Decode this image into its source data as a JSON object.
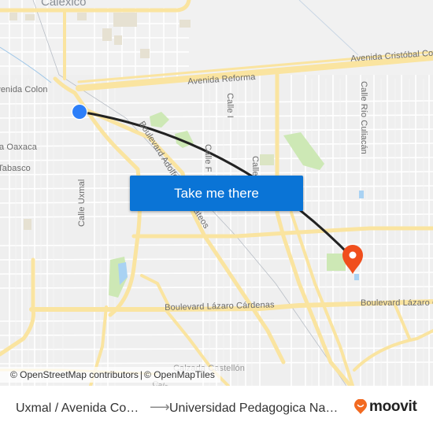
{
  "map": {
    "city_label": "Calexico",
    "street_labels": [
      {
        "id": "avenida-colon",
        "text": "Avenida Colon"
      },
      {
        "id": "avenida-reforma",
        "text": "Avenida Reforma"
      },
      {
        "id": "avenida-cristobal-colon",
        "text": "Avenida Cristóbal Colón"
      },
      {
        "id": "calle-i",
        "text": "Calle I"
      },
      {
        "id": "calle-rio-culiacan",
        "text": "Calle Río Culiacán"
      },
      {
        "id": "avenida-oaxaca",
        "text": "Avenida Oaxaca"
      },
      {
        "id": "avenida-tabasco",
        "text": "Avenida Tabasco"
      },
      {
        "id": "calle-uxmal",
        "text": "Calle Uxmal"
      },
      {
        "id": "boulevard-adolfo-lopez-mateos",
        "text": "Boulevard Adolfo López Mateos"
      },
      {
        "id": "calle-f",
        "text": "Calle F"
      },
      {
        "id": "calle-k",
        "text": "Calle K"
      },
      {
        "id": "boulevard-lazaro-cardenas",
        "text": "Boulevard Lázaro Cárdenas"
      },
      {
        "id": "boulevard-lazaro-cardenas-east",
        "text": "Boulevard Lázaro Cárdenas"
      },
      {
        "id": "calzada-castellon",
        "text": "Calzada Castellón"
      },
      {
        "id": "calz-fragment",
        "text": "Calz"
      }
    ],
    "origin_marker": {
      "label": "Uxmal / Avenida Colon",
      "color": "#2d7ff9"
    },
    "destination_marker": {
      "label": "Universidad Pedagogica Nacional",
      "color": "#f04e1c"
    },
    "route_line_color": "#222222",
    "colors": {
      "background": "#efefef",
      "major_road": "#fbe6a2",
      "minor_road": "#ffffff",
      "park": "#c9e6b0",
      "water": "#a9d2f3",
      "building_block": "#e5e0d0"
    }
  },
  "cta": {
    "take_me_there_label": "Take me there",
    "color": "#0a74d6"
  },
  "attribution": {
    "osm": "© OpenStreetMap contributors",
    "separator": "|",
    "omt": "© OpenMapTiles"
  },
  "footer": {
    "origin_text": "Uxmal / Avenida Co…",
    "arrow": "⟶",
    "destination_text": "Universidad Pedagogica Na…",
    "brand": "moovit",
    "brand_color": "#f26a21"
  }
}
